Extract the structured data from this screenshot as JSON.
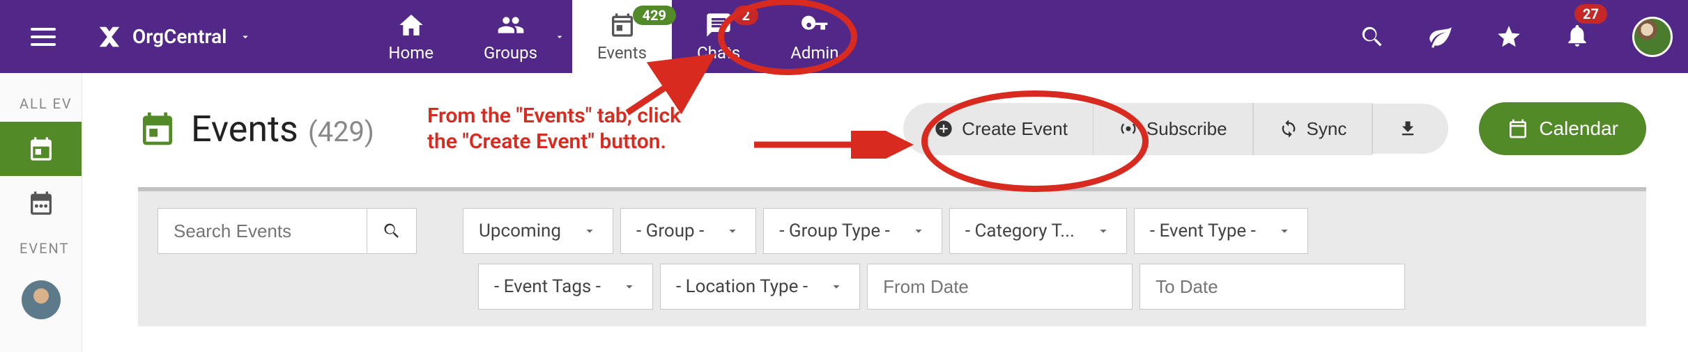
{
  "brand": "OrgCentral",
  "nav": {
    "home": "Home",
    "groups": "Groups",
    "events": "Events",
    "events_badge": "429",
    "chats": "Chats",
    "chats_badge": "2",
    "admin": "Admin"
  },
  "bell_badge": "27",
  "sidebar": {
    "all_label": "ALL EV",
    "event_label": "EVENT"
  },
  "page": {
    "title": "Events",
    "count": "(429)"
  },
  "annotation": {
    "line1": "From the \"Events\" tab, click",
    "line2": "the \"Create Event\" button."
  },
  "actions": {
    "create": "Create Event",
    "subscribe": "Subscribe",
    "sync": "Sync",
    "calendar": "Calendar"
  },
  "filters": {
    "search_placeholder": "Search Events",
    "upcoming": "Upcoming",
    "group": "- Group -",
    "group_type": "- Group Type -",
    "category": "- Category T...",
    "event_type": "- Event Type -",
    "event_tags": "- Event Tags -",
    "location_type": "- Location Type -",
    "from_placeholder": "From Date",
    "to_placeholder": "To Date"
  }
}
